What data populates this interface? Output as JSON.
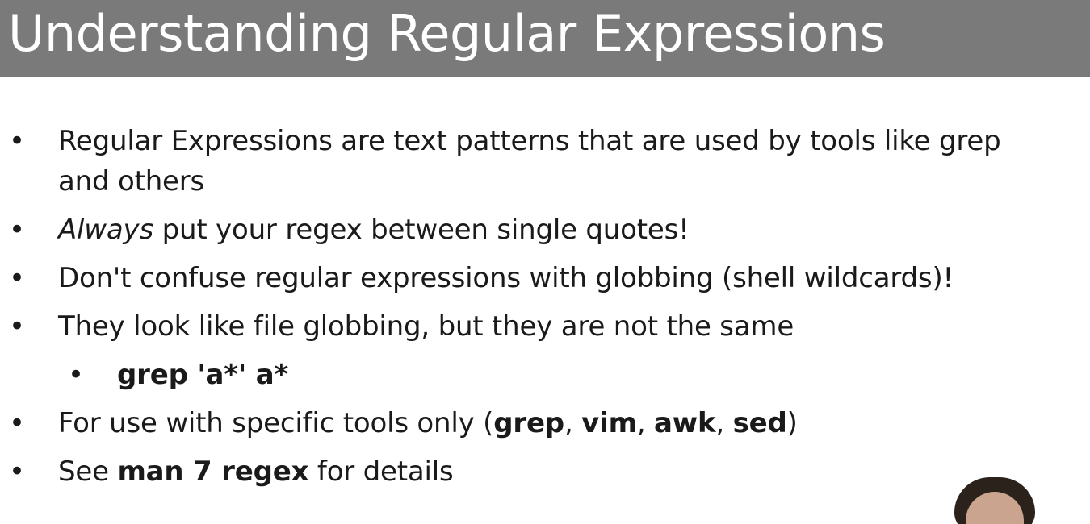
{
  "slide": {
    "title": "Understanding Regular Expressions",
    "bullets": [
      {
        "text": "Regular Expressions are text patterns that are used by tools like grep and others"
      },
      {
        "italic_lead": "Always",
        "rest": " put your regex between single quotes!"
      },
      {
        "text": "Don't confuse regular expressions with globbing (shell wildcards)!"
      },
      {
        "text": "They look like file globbing, but they are not the same"
      },
      {
        "sub": "grep 'a*' a*"
      },
      {
        "lead": "For use with specific tools only (",
        "tool1": "grep",
        "sep1": ", ",
        "tool2": "vim",
        "sep2": ", ",
        "tool3": "awk",
        "sep3": ", ",
        "tool4": "sed",
        "tail": ")"
      },
      {
        "lead": "See ",
        "bold": "man 7 regex",
        "tail": " for details"
      }
    ],
    "bullet_glyph": "•"
  },
  "presenter": {
    "icon": "presenter-avatar"
  }
}
